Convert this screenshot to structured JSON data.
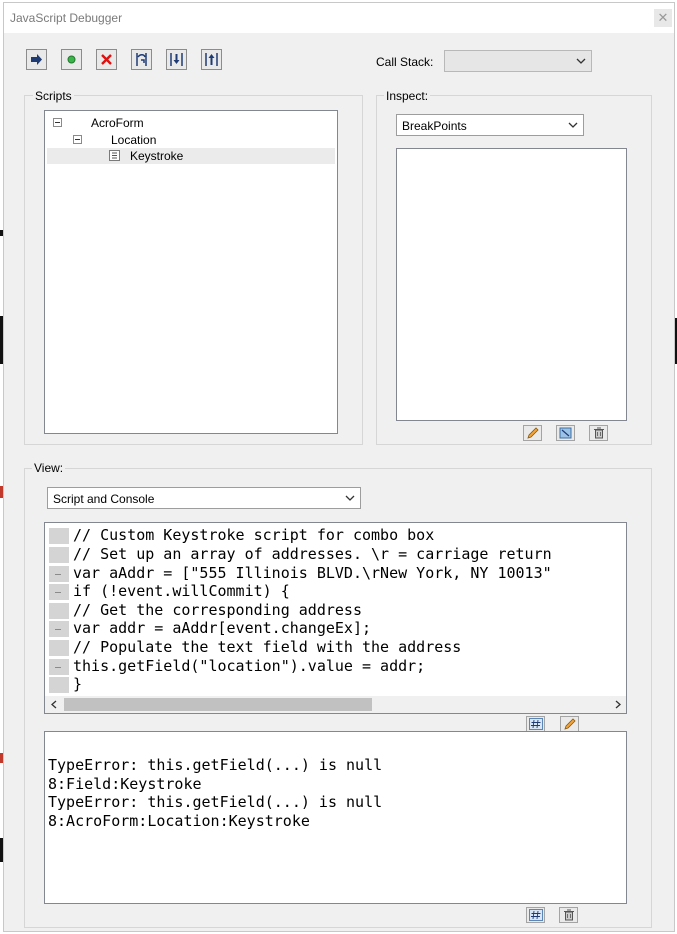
{
  "window": {
    "title": "JavaScript Debugger",
    "close_glyph": "✕"
  },
  "toolbar": {
    "buttons": [
      {
        "name": "resume-icon",
        "tooltip": "Resume"
      },
      {
        "name": "interrupt-icon",
        "tooltip": "Interrupt"
      },
      {
        "name": "quit-icon",
        "tooltip": "Quit"
      },
      {
        "name": "step-over-icon",
        "tooltip": "Step Over"
      },
      {
        "name": "step-into-icon",
        "tooltip": "Step Into"
      },
      {
        "name": "step-out-icon",
        "tooltip": "Step Out"
      }
    ],
    "call_stack_label": "Call Stack:",
    "call_stack_value": ""
  },
  "scripts": {
    "label": "Scripts",
    "tree": [
      {
        "label": "AcroForm",
        "expanded": true
      },
      {
        "label": "Location",
        "expanded": true
      },
      {
        "label": "Keystroke",
        "selected": true
      }
    ]
  },
  "inspect": {
    "label": "Inspect:",
    "selected": "BreakPoints",
    "buttons": [
      "edit-icon",
      "conditional-icon",
      "delete-icon"
    ]
  },
  "view": {
    "label": "View:",
    "selected": "Script and Console",
    "code_lines": [
      {
        "text": "// Custom Keystroke script for combo box",
        "marker": false
      },
      {
        "text": "// Set up an array of addresses. \\r = carriage return",
        "marker": false
      },
      {
        "text": "var aAddr = [\"555 Illinois BLVD.\\rNew York, NY 10013\"",
        "marker": true
      },
      {
        "text": "if (!event.willCommit) {",
        "marker": true
      },
      {
        "text": "// Get the corresponding address",
        "marker": false
      },
      {
        "text": "var addr = aAddr[event.changeEx];",
        "marker": true
      },
      {
        "text": "// Populate the text field with the address",
        "marker": false
      },
      {
        "text": "this.getField(\"location\").value = addr;",
        "marker": true
      },
      {
        "text": "}",
        "marker": false
      }
    ],
    "console_lines": [
      "",
      "TypeError: this.getField(...) is null",
      "8:Field:Keystroke",
      "TypeError: this.getField(...) is null",
      "8:AcroForm:Location:Keystroke"
    ]
  },
  "colors": {
    "window_bg": "#f0f0f0",
    "gutter": "#d4d4d4",
    "border": "#828790"
  }
}
